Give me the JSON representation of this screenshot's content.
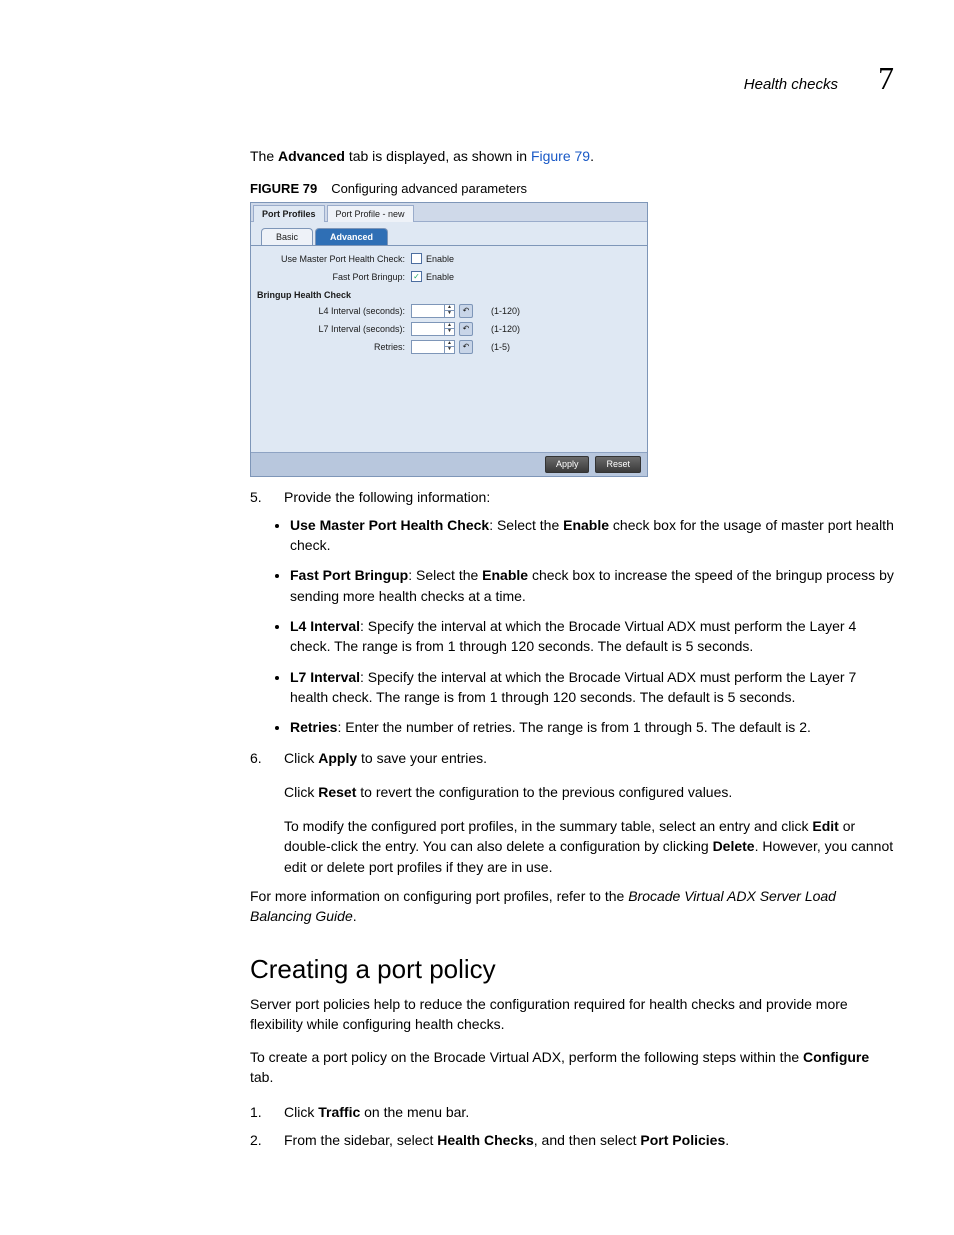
{
  "header": {
    "section": "Health checks",
    "chapter": "7"
  },
  "intro": {
    "prefix": "The ",
    "bold1": "Advanced",
    "mid": " tab is displayed, as shown in ",
    "link": "Figure 79",
    "suffix": "."
  },
  "figcaption": {
    "num": "FIGURE 79",
    "title": "Configuring advanced parameters"
  },
  "screenshot": {
    "fileTabs": {
      "left": "Port Profiles",
      "right": "Port Profile - new"
    },
    "innerTabs": {
      "basic": "Basic",
      "advanced": "Advanced"
    },
    "rows": {
      "master": {
        "label": "Use Master Port Health Check:",
        "text": "Enable",
        "checked": false
      },
      "fast": {
        "label": "Fast Port Bringup:",
        "text": "Enable",
        "checked": true
      }
    },
    "group": "Bringup Health Check",
    "fields": {
      "l4": {
        "label": "L4 Interval (seconds):",
        "range": "(1-120)"
      },
      "l7": {
        "label": "L7 Interval (seconds):",
        "range": "(1-120)"
      },
      "retries": {
        "label": "Retries:",
        "range": "(1-5)"
      }
    },
    "buttons": {
      "apply": "Apply",
      "reset": "Reset"
    }
  },
  "step5": {
    "num": "5.",
    "text": "Provide the following information:"
  },
  "bullets": [
    {
      "bold": "Use Master Port Health Check",
      "seg1": ": Select the ",
      "bold2": "Enable",
      "seg2": " check box for the usage of master port health check."
    },
    {
      "bold": "Fast Port Bringup",
      "seg1": ": Select the ",
      "bold2": "Enable",
      "seg2": " check box to increase the speed of the bringup process by sending more health checks at a time."
    },
    {
      "bold": "L4 Interval",
      "seg1": ": Specify the interval at which the Brocade Virtual ADX must perform the Layer 4 check. The range is from 1 through 120 seconds. The default is 5 seconds."
    },
    {
      "bold": "L7 Interval",
      "seg1": ": Specify the interval at which the Brocade Virtual ADX must perform the Layer 7 health check. The range is from 1 through 120 seconds. The default is 5 seconds."
    },
    {
      "bold": "Retries",
      "seg1": ": Enter the number of retries. The range is from 1 through 5. The default is 2."
    }
  ],
  "step6": {
    "num": "6.",
    "seg1": "Click ",
    "bold1": "Apply",
    "seg2": " to save your entries.",
    "sub1a": "Click ",
    "sub1bold": "Reset",
    "sub1b": " to revert the configuration to the previous configured values.",
    "sub2a": "To modify the configured port profiles, in the summary table, select an entry and click ",
    "sub2bold1": "Edit",
    "sub2b": " or double-click the entry. You can also delete a configuration by clicking ",
    "sub2bold2": "Delete",
    "sub2c": ". However, you cannot edit or delete port profiles if they are in use."
  },
  "more": {
    "a": "For more information on configuring port profiles, refer to the ",
    "i": "Brocade Virtual ADX Server Load Balancing Guide",
    "b": "."
  },
  "sect": "Creating a port policy",
  "p1": "Server port policies help to reduce the configuration required for health checks and provide more flexibility while configuring health checks.",
  "p2": {
    "a": "To create a port policy on the Brocade Virtual ADX, perform the following steps within the ",
    "bold": "Configure",
    "b": " tab."
  },
  "stepA": {
    "num": "1.",
    "a": "Click ",
    "bold": "Traffic",
    "b": " on the menu bar."
  },
  "stepB": {
    "num": "2.",
    "a": "From the sidebar, select ",
    "bold1": "Health Checks",
    "b": ", and then select ",
    "bold2": "Port Policies",
    "c": "."
  }
}
